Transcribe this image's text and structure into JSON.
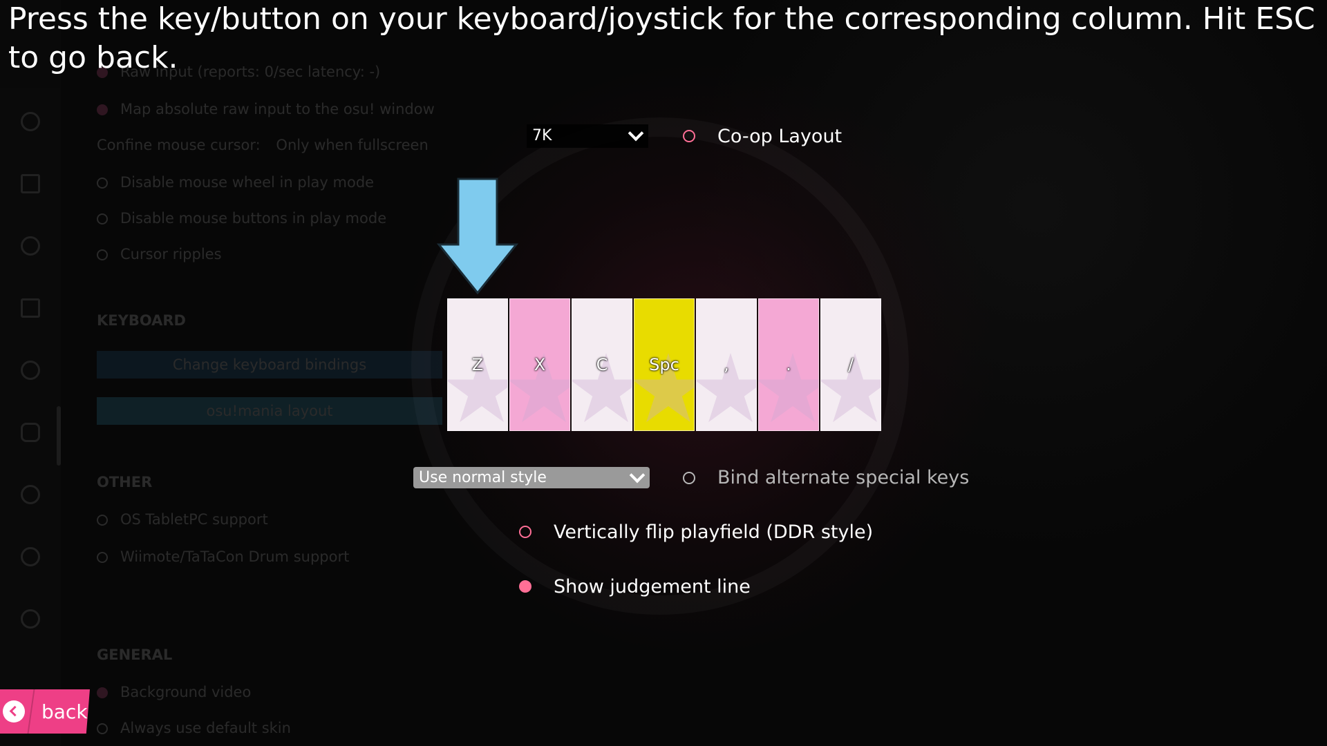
{
  "instructions": "Press the key/button on your keyboard/joystick for the corresponding column. Hit ESC to go back.",
  "layout_select": {
    "value": "7K"
  },
  "coop_layout": {
    "label": "Co-op Layout",
    "checked": false
  },
  "keys": [
    {
      "label": "Z",
      "color": "#f4ecf2"
    },
    {
      "label": "X",
      "color": "#f4a8d4"
    },
    {
      "label": "C",
      "color": "#f4ecf2"
    },
    {
      "label": "Spc",
      "color": "#e8dc00"
    },
    {
      "label": ",",
      "color": "#f4ecf2"
    },
    {
      "label": ".",
      "color": "#f4a8d4"
    },
    {
      "label": "/",
      "color": "#f4ecf2"
    }
  ],
  "arrow_color": "#7fcbee",
  "style_select": {
    "value": "Use normal style"
  },
  "bind_alternate": {
    "label": "Bind alternate special keys",
    "checked": false
  },
  "vertical_flip": {
    "label": "Vertically flip playfield (DDR style)",
    "checked": false
  },
  "judgement_line": {
    "label": "Show judgement line",
    "checked": true
  },
  "back_button": {
    "label": "back"
  },
  "background_settings": {
    "raw_input": "Raw input (reports: 0/sec latency: -)",
    "map_absolute": "Map absolute raw input to the osu! window",
    "confine_label": "Confine mouse cursor:",
    "confine_value": "Only when fullscreen",
    "disable_wheel": "Disable mouse wheel in play mode",
    "disable_buttons": "Disable mouse buttons in play mode",
    "cursor_ripples": "Cursor ripples",
    "keyboard_header": "KEYBOARD",
    "change_bindings": "Change keyboard bindings",
    "mania_layout": "osu!mania layout",
    "other_header": "OTHER",
    "tabletpc": "OS TabletPC support",
    "wiimote": "Wiimote/TaTaCon Drum support",
    "general_header": "GENERAL",
    "bg_video": "Background video",
    "default_skin": "Always use default skin"
  }
}
